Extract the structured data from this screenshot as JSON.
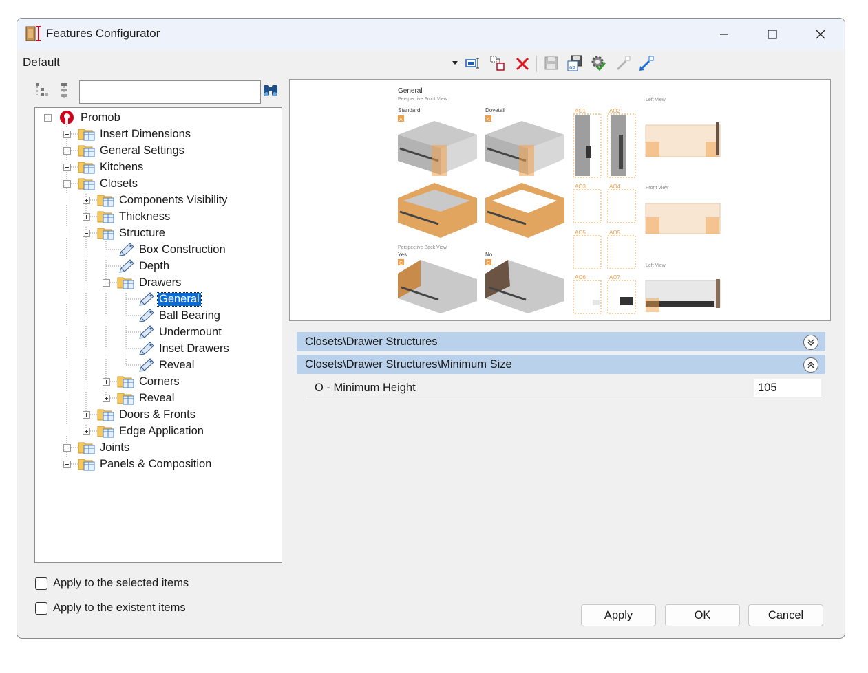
{
  "window": {
    "title": "Features Configurator"
  },
  "toolbar": {
    "profile": "Default"
  },
  "search": {
    "placeholder": ""
  },
  "tree": {
    "root": "Promob",
    "insert_dimensions": "Insert Dimensions",
    "general_settings": "General Settings",
    "kitchens": "Kitchens",
    "closets": "Closets",
    "components_visibility": "Components Visibility",
    "thickness": "Thickness",
    "structure": "Structure",
    "box_construction": "Box Construction",
    "depth": "Depth",
    "drawers": "Drawers",
    "general": "General",
    "ball_bearing": "Ball Bearing",
    "undermount": "Undermount",
    "inset_drawers": "Inset Drawers",
    "reveal_leaf": "Reveal",
    "corners": "Corners",
    "reveal": "Reveal",
    "doors_fronts": "Doors & Fronts",
    "edge_application": "Edge Application",
    "joints": "Joints",
    "panels_composition": "Panels & Composition"
  },
  "preview": {
    "general": "General",
    "perspective_front": "Perspective Front View",
    "standard": "Standard",
    "dovetail": "Dovetail",
    "perspective_back": "Perspective Back View",
    "yes": "Yes",
    "no": "No",
    "left_view": "Left View",
    "front_view": "Front View",
    "left_view2": "Left View",
    "tag_a": "A",
    "tag_c": "C",
    "ao1": "AO1",
    "ao2": "AO2",
    "ao3": "AO3",
    "ao4": "AO4",
    "ao5": "AO5",
    "ao6": "AO6",
    "ao7": "AO7"
  },
  "properties": {
    "category1": "Closets\\Drawer Structures",
    "category2": "Closets\\Drawer Structures\\Minimum Size",
    "row_name": "O - Minimum Height",
    "row_value": "105"
  },
  "options": {
    "apply_selected": "Apply to the selected items",
    "apply_existent": "Apply to the existent items"
  },
  "buttons": {
    "apply": "Apply",
    "ok": "OK",
    "cancel": "Cancel"
  },
  "colors": {
    "selection": "#0b6bd3",
    "category": "#b9d1ea",
    "accent_orange": "#f0a04b"
  }
}
